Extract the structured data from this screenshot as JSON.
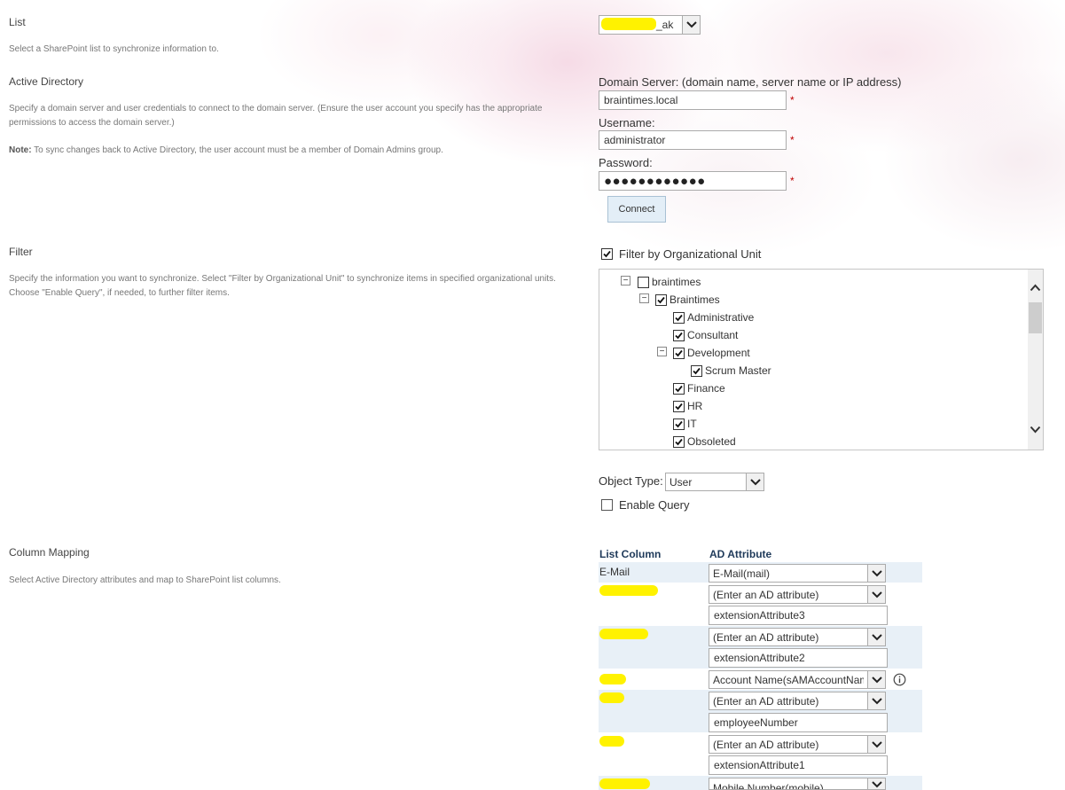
{
  "list_section": {
    "title": "List",
    "description": "Select a SharePoint list to synchronize information to.",
    "selected_list_visible": "_ak"
  },
  "ad_section": {
    "title": "Active Directory",
    "description": "Specify a domain server and user credentials to connect to the domain server. (Ensure the user account you specify has the appropriate permissions to access the domain server.)",
    "note_label": "Note:",
    "note_text": "To sync changes back to Active Directory, the user account must be a member of Domain Admins group.",
    "domain_label": "Domain Server: (domain name, server name or IP address)",
    "domain_value": "braintimes.local",
    "username_label": "Username:",
    "username_value": "administrator",
    "password_label": "Password:",
    "password_mask": "●●●●●●●●●●●●",
    "required_marker": "*",
    "connect_label": "Connect"
  },
  "filter_section": {
    "title": "Filter",
    "description": "Specify the information you want to synchronize. Select \"Filter by Organizational Unit\" to synchronize items in specified organizational units. Choose \"Enable Query\", if needed, to further filter items.",
    "filter_ou_label": "Filter by Organizational Unit",
    "filter_ou_checked": true,
    "tree": [
      {
        "label": "braintimes",
        "checked": false,
        "expander": "−"
      },
      {
        "label": "Braintimes",
        "checked": true,
        "expander": "−"
      },
      {
        "label": "Administrative",
        "checked": true
      },
      {
        "label": "Consultant",
        "checked": true
      },
      {
        "label": "Development",
        "checked": true,
        "expander": "−"
      },
      {
        "label": "Scrum Master",
        "checked": true
      },
      {
        "label": "Finance",
        "checked": true
      },
      {
        "label": "HR",
        "checked": true
      },
      {
        "label": "IT",
        "checked": true
      },
      {
        "label": "Obsoleted",
        "checked": true
      }
    ],
    "object_type_label": "Object Type:",
    "object_type_value": "User",
    "enable_query_label": "Enable Query",
    "enable_query_checked": false
  },
  "mapping_section": {
    "title": "Column Mapping",
    "description": "Select Active Directory attributes and map to SharePoint list columns.",
    "col_list_header": "List Column",
    "col_ad_header": "AD Attribute",
    "rows": [
      {
        "list_column": "E-Mail",
        "ad_attribute": "E-Mail(mail)",
        "custom": ""
      },
      {
        "list_column": "",
        "ad_attribute": "(Enter an AD attribute)",
        "custom": "extensionAttribute3"
      },
      {
        "list_column": "",
        "ad_attribute": "(Enter an AD attribute)",
        "custom": "extensionAttribute2"
      },
      {
        "list_column": "",
        "ad_attribute": "Account Name(sAMAccountName)",
        "custom": ""
      },
      {
        "list_column": "",
        "ad_attribute": "(Enter an AD attribute)",
        "custom": "employeeNumber"
      },
      {
        "list_column": "",
        "ad_attribute": "(Enter an AD attribute)",
        "custom": "extensionAttribute1"
      },
      {
        "list_column": "",
        "ad_attribute": "Mobile Number(mobile)",
        "custom": ""
      }
    ]
  },
  "colors": {
    "accent_link": "#1f3a5a",
    "required": "#bf0000",
    "row_band": "#e8f0f7",
    "redaction": "#fff200"
  }
}
